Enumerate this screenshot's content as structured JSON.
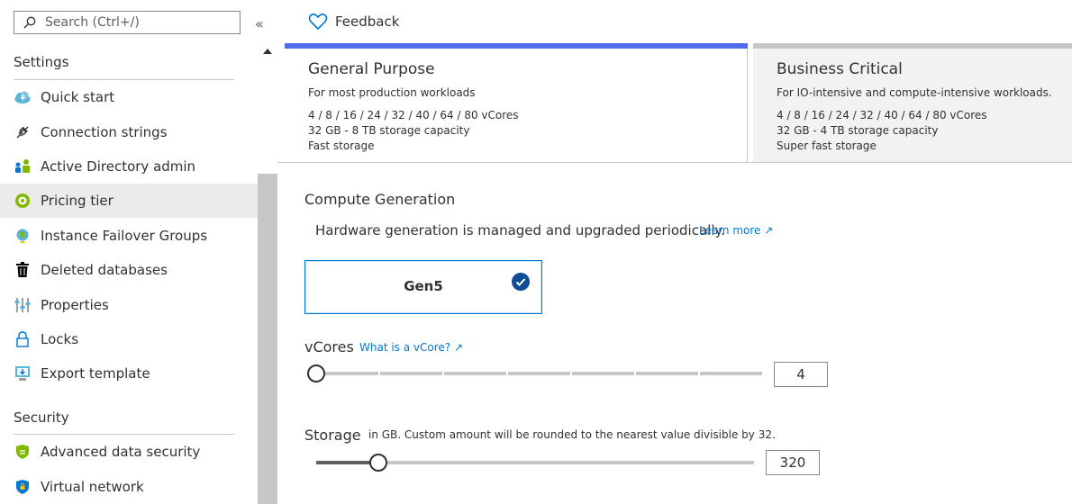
{
  "sidebar": {
    "search_placeholder": "Search (Ctrl+/)",
    "collapse_glyph": "«",
    "sections": [
      {
        "title": "Settings"
      },
      {
        "title": "Security"
      }
    ],
    "settings_items": [
      {
        "label": "Quick start",
        "icon": "cloud-lightning-icon"
      },
      {
        "label": "Connection strings",
        "icon": "plug-icon"
      },
      {
        "label": "Active Directory admin",
        "icon": "users-icon"
      },
      {
        "label": "Pricing tier",
        "icon": "pricing-icon",
        "selected": true
      },
      {
        "label": "Instance Failover Groups",
        "icon": "globe-icon"
      },
      {
        "label": "Deleted databases",
        "icon": "trash-icon"
      },
      {
        "label": "Properties",
        "icon": "properties-icon"
      },
      {
        "label": "Locks",
        "icon": "lock-icon"
      },
      {
        "label": "Export template",
        "icon": "export-icon"
      }
    ],
    "security_items": [
      {
        "label": "Advanced data security",
        "icon": "shield-icon"
      },
      {
        "label": "Virtual network",
        "icon": "virtual-network-icon"
      }
    ]
  },
  "toolbar": {
    "feedback_label": "Feedback"
  },
  "tiers": [
    {
      "name": "General Purpose",
      "description": "For most production workloads",
      "specs": [
        "4 / 8 / 16 / 24 / 32 / 40 / 64 / 80 vCores",
        "32 GB - 8 TB storage capacity",
        "Fast storage"
      ],
      "selected": true
    },
    {
      "name": "Business Critical",
      "description": "For IO-intensive and compute-intensive workloads.",
      "specs": [
        "4 / 8 / 16 / 24 / 32 / 40 / 64 / 80 vCores",
        "32 GB - 4 TB storage capacity",
        "Super fast storage"
      ],
      "selected": false
    }
  ],
  "compute": {
    "title": "Compute Generation",
    "hardware_text": "Hardware generation is managed and upgraded periodically.",
    "learn_more": "Learn more ↗",
    "generation": "Gen5"
  },
  "vcores": {
    "title": "vCores",
    "link": "What is a vCore? ↗",
    "value": "4",
    "slider_fraction": 0.0
  },
  "storage": {
    "title": "Storage",
    "note": "in GB. Custom amount will be rounded to the nearest value divisible by 32.",
    "value": "320",
    "slider_fraction": 0.143
  },
  "colors": {
    "accent": "#0078d4",
    "tier_selected": "#4f6bed",
    "selected_nav_bg": "#edebe9"
  }
}
